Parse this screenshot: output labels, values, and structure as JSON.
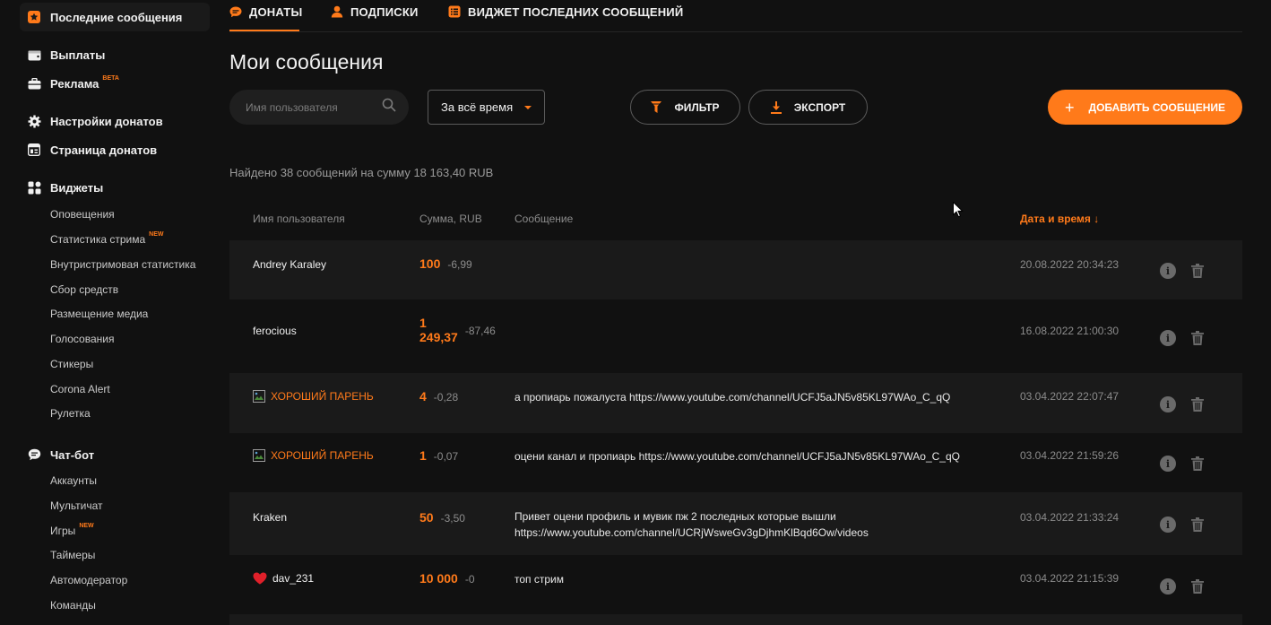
{
  "sidebar": {
    "top_items": [
      {
        "label": "Последние сообщения"
      },
      {
        "label": "Выплаты"
      },
      {
        "label": "Реклама",
        "tag": "BETA"
      },
      {
        "label": "Настройки донатов"
      },
      {
        "label": "Страница донатов"
      },
      {
        "label": "Виджеты"
      }
    ],
    "widgets_sub": [
      {
        "label": "Оповещения"
      },
      {
        "label": "Статистика стрима",
        "tag": "NEW"
      },
      {
        "label": "Внутристримовая статистика"
      },
      {
        "label": "Сбор средств"
      },
      {
        "label": "Размещение медиа"
      },
      {
        "label": "Голосования"
      },
      {
        "label": "Стикеры"
      },
      {
        "label": "Corona Alert"
      },
      {
        "label": "Рулетка"
      }
    ],
    "chatbot": {
      "label": "Чат-бот"
    },
    "chatbot_sub": [
      {
        "label": "Аккаунты"
      },
      {
        "label": "Мультичат"
      },
      {
        "label": "Игры",
        "tag": "NEW"
      },
      {
        "label": "Таймеры"
      },
      {
        "label": "Автомодератор"
      },
      {
        "label": "Команды"
      }
    ]
  },
  "tabs": [
    {
      "label": "ДОНАТЫ",
      "active": true
    },
    {
      "label": "ПОДПИСКИ"
    },
    {
      "label": "ВИДЖЕТ ПОСЛЕДНИХ СООБЩЕНИЙ"
    }
  ],
  "page_title": "Мои сообщения",
  "search": {
    "placeholder": "Имя пользователя",
    "value": ""
  },
  "period_select": {
    "value": "За всё время"
  },
  "filter_label": "ФИЛЬТР",
  "export_label": "ЭКСПОРТ",
  "add_label": "ДОБАВИТЬ СООБЩЕНИЕ",
  "summary": "Найдено 38 сообщений на сумму 18 163,40 RUB",
  "table": {
    "headers": {
      "user": "Имя пользователя",
      "amount": "Сумма, RUB",
      "message": "Сообщение",
      "date": "Дата и время ↓"
    },
    "rows": [
      {
        "user": "Andrey Karaley",
        "amount": "100",
        "fee": "-6,99",
        "message": "",
        "message2": "",
        "date": "20.08.2022 20:34:23"
      },
      {
        "user": "ferocious",
        "amount": "1",
        "amount2": "249,37",
        "fee": "-87,46",
        "message": "",
        "message2": "",
        "date": "16.08.2022 21:00:30"
      },
      {
        "user": "ХОРОШИЙ ПАРЕНЬ",
        "amount": "4",
        "fee": "-0,28",
        "message": "а пропиарь пожалуста https://www.youtube.com/channel/UCFJ5aJN5v85KL97WAo_C_qQ",
        "message2": "",
        "date": "03.04.2022 22:07:47"
      },
      {
        "user": "ХОРОШИЙ ПАРЕНЬ",
        "amount": "1",
        "fee": "-0,07",
        "message": "оцени канал и пропиарь https://www.youtube.com/channel/UCFJ5aJN5v85KL97WAo_C_qQ",
        "message2": "",
        "date": "03.04.2022 21:59:26"
      },
      {
        "user": "Kraken",
        "amount": "50",
        "fee": "-3,50",
        "message": "Привет оцени профиль и мувик пж 2 последных которые вышли",
        "message2": "https://www.youtube.com/channel/UCRjWsweGv3gDjhmKlBqd6Ow/videos",
        "date": "03.04.2022 21:33:24"
      },
      {
        "user": "dav_231",
        "amount": "10 000",
        "fee": "-0",
        "message": "топ стрим",
        "message2": "",
        "date": "03.04.2022 21:15:39"
      }
    ]
  },
  "colors": {
    "accent": "#ff7a1a",
    "background": "#111111",
    "row_shade": "#1a1a1a"
  },
  "icons": {
    "info": "info-icon",
    "delete": "trash-icon"
  }
}
